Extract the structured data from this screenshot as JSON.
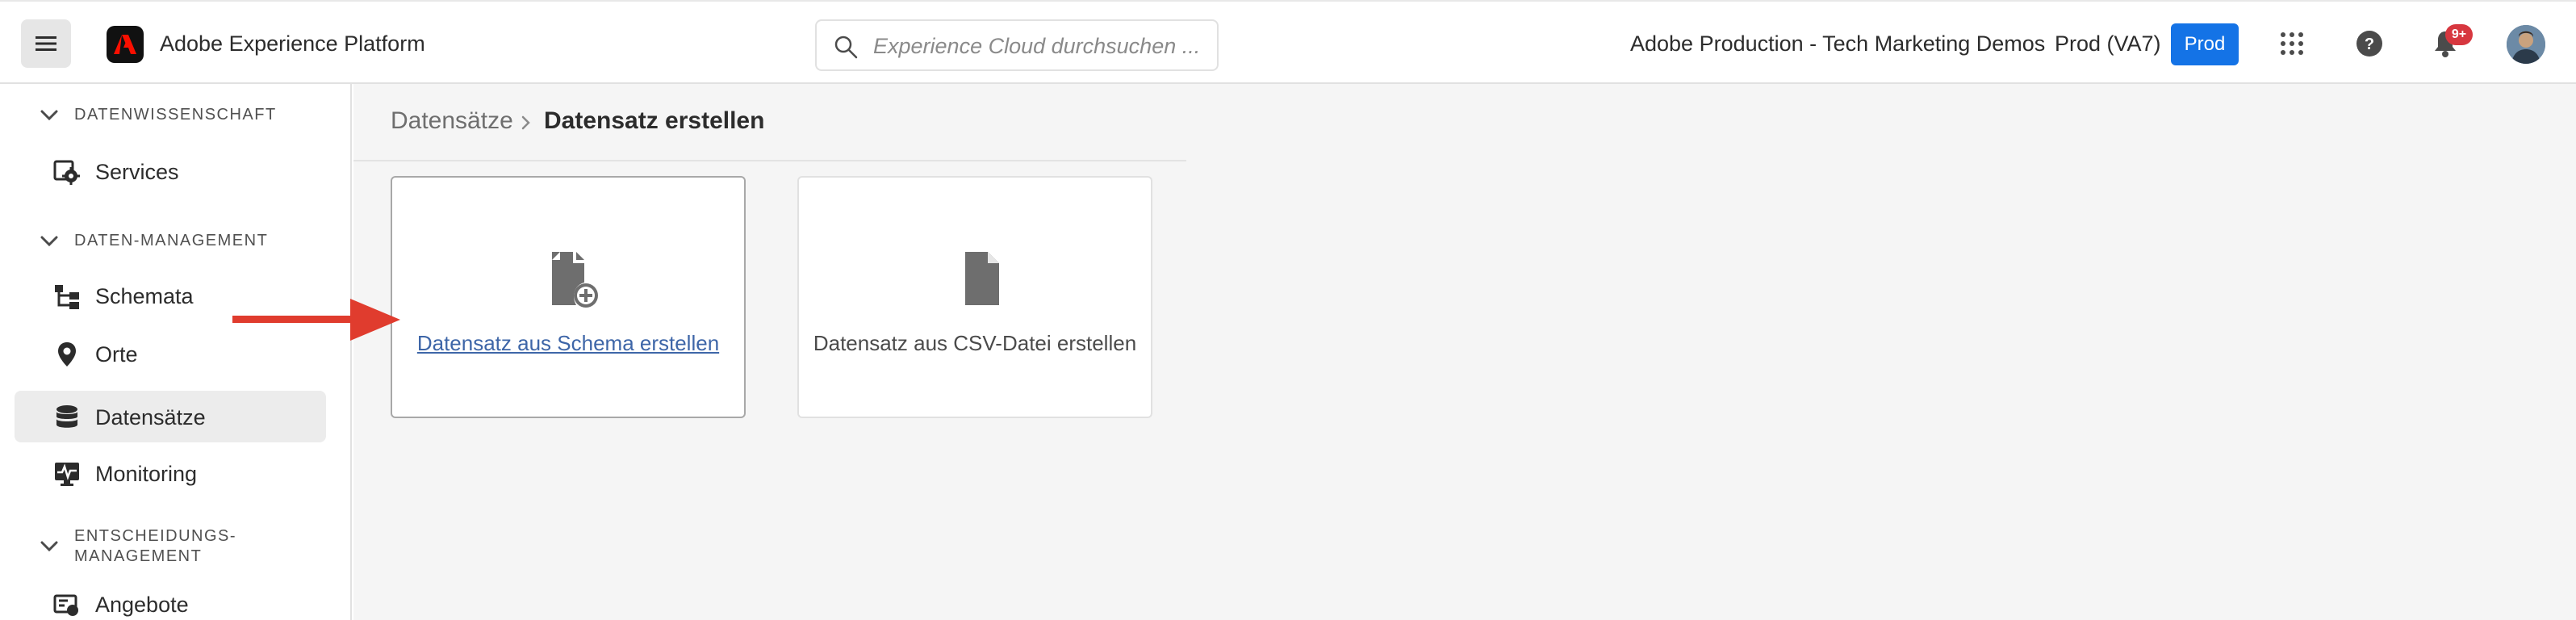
{
  "header": {
    "menu_icon": "hamburger-icon",
    "app_logo_icon": "adobe-logo-icon",
    "app_title": "Adobe Experience Platform",
    "search": {
      "placeholder": "Experience Cloud durchsuchen ...",
      "value": "",
      "icon": "search-icon"
    },
    "org_name": "Adobe Production - Tech Marketing Demos",
    "sandbox_name": "Prod (VA7)",
    "environment_badge": "Prod",
    "apps_icon": "app-grid-icon",
    "help_icon": "help-icon",
    "notifications_icon": "bell-icon",
    "notifications_count": "9+",
    "avatar_icon": "user-avatar"
  },
  "sidebar": {
    "sections": [
      {
        "label": "DATENWISSENSCHAFT",
        "icon": "chevron-down-icon"
      },
      {
        "label": "DATEN-MANAGEMENT",
        "icon": "chevron-down-icon"
      },
      {
        "label_line1": "ENTSCHEIDUNGS-",
        "label_line2": "MANAGEMENT",
        "icon": "chevron-down-icon"
      }
    ],
    "items": [
      {
        "label": "Services",
        "icon": "services-icon"
      },
      {
        "label": "Schemata",
        "icon": "schema-icon"
      },
      {
        "label": "Orte",
        "icon": "location-pin-icon"
      },
      {
        "label": "Datensätze",
        "icon": "database-icon",
        "active": true
      },
      {
        "label": "Monitoring",
        "icon": "monitoring-icon"
      },
      {
        "label": "Angebote",
        "icon": "offers-icon"
      }
    ]
  },
  "breadcrumb": {
    "parent": "Datensätze",
    "current": "Datensatz erstellen",
    "separator_icon": "chevron-right-icon"
  },
  "cards": [
    {
      "label": "Datensatz aus Schema erstellen",
      "icon": "file-add-icon",
      "selected": true
    },
    {
      "label": "Datensatz aus CSV-Datei erstellen",
      "icon": "file-icon",
      "selected": false
    }
  ],
  "annotation": {
    "icon": "red-arrow-icon",
    "color": "#e03c2e"
  },
  "colors": {
    "accent": "#1473e6",
    "notification": "#d7373f",
    "link": "#3e66a8",
    "annotation_arrow": "#e03c2e"
  }
}
